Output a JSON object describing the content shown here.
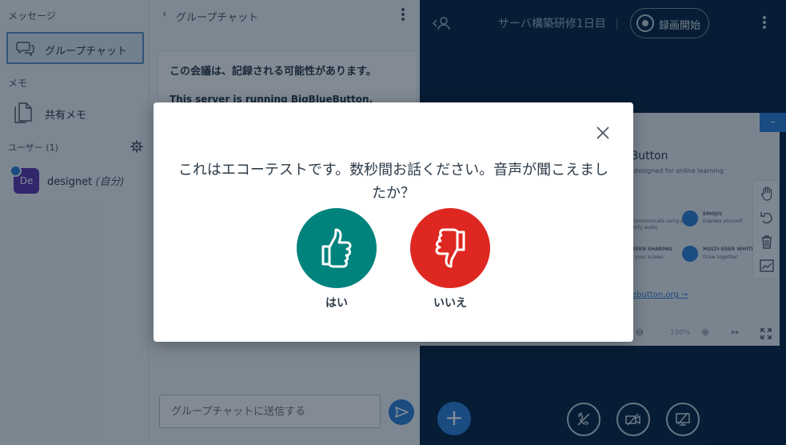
{
  "userlist": {
    "messages_title": "メッセージ",
    "group_chat_label": "グループチャット",
    "memo_title": "メモ",
    "shared_memo_label": "共有メモ",
    "users_title": "ユーザー (1)",
    "users": [
      {
        "initials": "De",
        "name": "designet",
        "self_tag": "(自分)"
      }
    ]
  },
  "chat": {
    "header_title": "グループチャット",
    "welcome_line1": "この会議は、記録される可能性があります。",
    "welcome_line2": "This server is running BigBlueButton.",
    "input_placeholder": "グループチャットに送信する"
  },
  "main": {
    "meeting_title": "サーバ構築研修1日目",
    "record_label": "録画開始",
    "slide": {
      "title_fragment": "eButton",
      "subtitle_fragment": "n designed for online learning",
      "features": [
        "EMOJIS",
        "Express yourself",
        "communicate using sign",
        "ority audio",
        "REEN SHARING",
        "r your screen",
        "MULTI-USER WHITEBOA",
        "Draw together"
      ],
      "link_fragment": "ebutton.org →",
      "zoom_label": "100%",
      "minimize_label": "–"
    }
  },
  "modal": {
    "message": "これはエコーテストです。数秒間お話ください。音声が聞こえましたか？",
    "yes_label": "はい",
    "no_label": "いいえ",
    "yes_color": "#00827d",
    "no_color": "#df2721"
  }
}
